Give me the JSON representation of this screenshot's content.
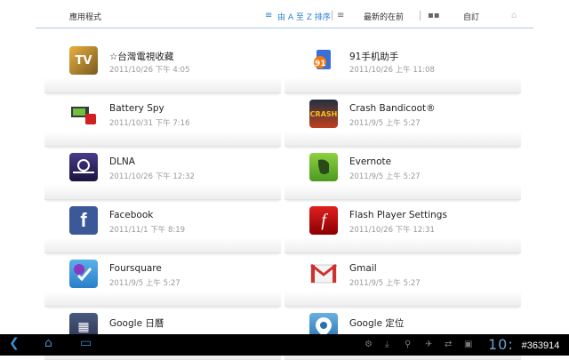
{
  "topbar": {
    "title": "應用程式",
    "sort_label": "由 A 至 Z 排序",
    "recent_label": "最新的在前",
    "custom_label": "自訂"
  },
  "apps": [
    {
      "name": "☆台灣電視收藏",
      "date": "2011/10/26 下午 4:05",
      "icon": "tv-app-icon"
    },
    {
      "name": "91手机助手",
      "date": "2011/10/26 上午 11:08",
      "icon": "91-assistant-icon"
    },
    {
      "name": "Battery Spy",
      "date": "2011/10/31 下午 7:16",
      "icon": "battery-spy-icon"
    },
    {
      "name": "Crash Bandicoot®",
      "date": "2011/9/5 上午 5:27",
      "icon": "crash-bandicoot-icon"
    },
    {
      "name": "DLNA",
      "date": "2011/10/26 下午 12:32",
      "icon": "dlna-icon"
    },
    {
      "name": "Evernote",
      "date": "2011/9/5 上午 5:27",
      "icon": "evernote-icon"
    },
    {
      "name": "Facebook",
      "date": "2011/11/1 下午 8:19",
      "icon": "facebook-icon"
    },
    {
      "name": "Flash Player Settings",
      "date": "2011/10/26 下午 12:31",
      "icon": "flash-icon"
    },
    {
      "name": "Foursquare",
      "date": "2011/9/5 上午 5:27",
      "icon": "foursquare-icon"
    },
    {
      "name": "Gmail",
      "date": "2011/9/5 上午 5:27",
      "icon": "gmail-icon"
    },
    {
      "name": "Google 日曆",
      "date": "",
      "icon": "calendar-icon"
    },
    {
      "name": "Google 定位",
      "date": "",
      "icon": "latitude-icon"
    }
  ],
  "sysbar": {
    "clock": "10:05",
    "watermark": "#363914"
  },
  "colors": {
    "accent": "#2a7fd4",
    "sysbar_icon": "#3c8fd0"
  }
}
